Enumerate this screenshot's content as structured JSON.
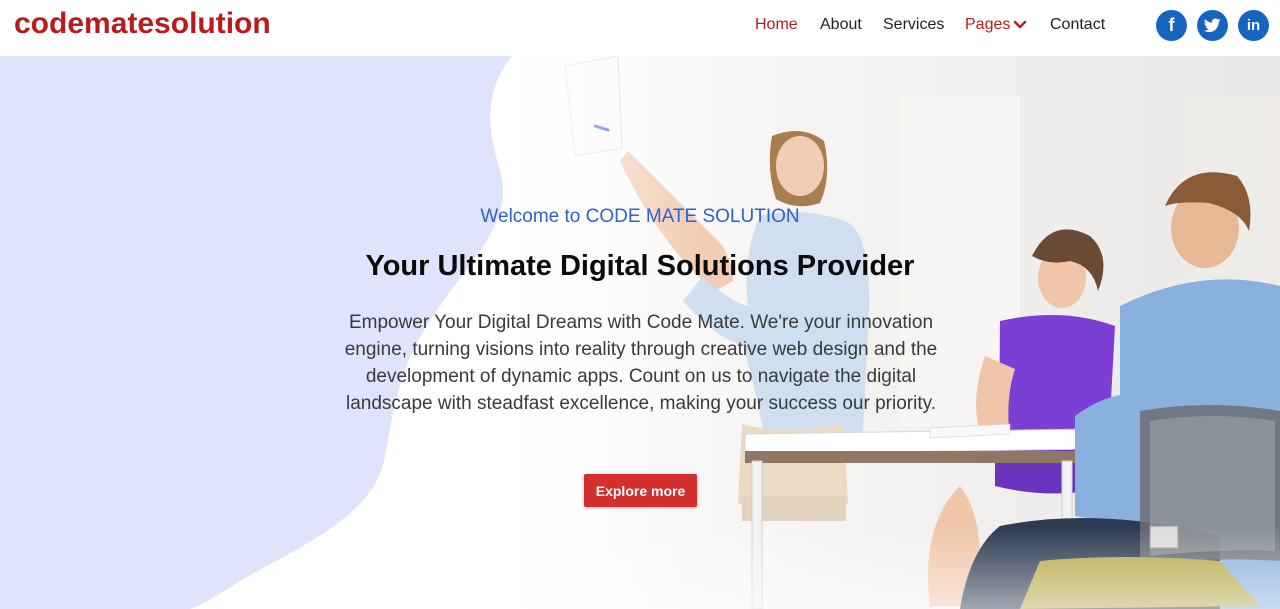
{
  "brand": {
    "name": "codematesolution",
    "color": "#b71c1c"
  },
  "nav": {
    "items": [
      {
        "label": "Home",
        "active": true
      },
      {
        "label": "About"
      },
      {
        "label": "Services"
      },
      {
        "label": "Pages",
        "has_dropdown": true
      },
      {
        "label": "Contact"
      }
    ]
  },
  "socials": [
    {
      "name": "facebook",
      "icon": "facebook-icon",
      "glyph": "f"
    },
    {
      "name": "twitter",
      "icon": "twitter-icon"
    },
    {
      "name": "linkedin",
      "icon": "linkedin-icon",
      "glyph": "in"
    }
  ],
  "hero": {
    "welcome": "Welcome to CODE MATE SOLUTION",
    "headline": "Your Ultimate Digital Solutions Provider",
    "description": "Empower Your Digital Dreams with Code Mate. We're your innovation engine, turning visions into reality through creative web design and the development of dynamic apps. Count on us to navigate the digital landscape with steadfast excellence, making your success our priority.",
    "cta_label": "Explore more"
  },
  "colors": {
    "accent_red": "#d32f2f",
    "brand_red": "#b71c1c",
    "social_blue": "#1565c0",
    "welcome_blue": "#2f5fd7",
    "blob_lavender": "#dfe3fb"
  }
}
